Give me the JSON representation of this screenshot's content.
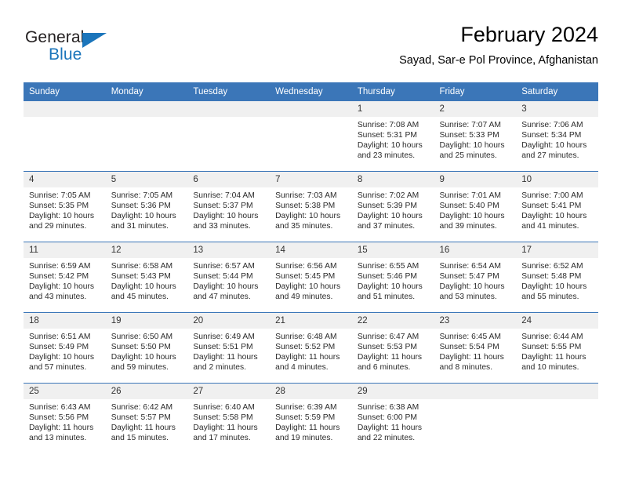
{
  "brand": {
    "name_part1": "General",
    "name_part2": "Blue"
  },
  "header": {
    "title": "February 2024",
    "subtitle": "Sayad, Sar-e Pol Province, Afghanistan"
  },
  "colors": {
    "header_blue": "#3b76b8",
    "brand_blue": "#1b75bb",
    "daynum_bg": "#f0f0f0"
  },
  "weekday_headers": [
    "Sunday",
    "Monday",
    "Tuesday",
    "Wednesday",
    "Thursday",
    "Friday",
    "Saturday"
  ],
  "weeks": [
    [
      {
        "day": "",
        "blank": true,
        "sunrise": "",
        "sunset": "",
        "daylight1": "",
        "daylight2": ""
      },
      {
        "day": "",
        "blank": true,
        "sunrise": "",
        "sunset": "",
        "daylight1": "",
        "daylight2": ""
      },
      {
        "day": "",
        "blank": true,
        "sunrise": "",
        "sunset": "",
        "daylight1": "",
        "daylight2": ""
      },
      {
        "day": "",
        "blank": true,
        "sunrise": "",
        "sunset": "",
        "daylight1": "",
        "daylight2": ""
      },
      {
        "day": "1",
        "sunrise": "Sunrise: 7:08 AM",
        "sunset": "Sunset: 5:31 PM",
        "daylight1": "Daylight: 10 hours",
        "daylight2": "and 23 minutes."
      },
      {
        "day": "2",
        "sunrise": "Sunrise: 7:07 AM",
        "sunset": "Sunset: 5:33 PM",
        "daylight1": "Daylight: 10 hours",
        "daylight2": "and 25 minutes."
      },
      {
        "day": "3",
        "sunrise": "Sunrise: 7:06 AM",
        "sunset": "Sunset: 5:34 PM",
        "daylight1": "Daylight: 10 hours",
        "daylight2": "and 27 minutes."
      }
    ],
    [
      {
        "day": "4",
        "sunrise": "Sunrise: 7:05 AM",
        "sunset": "Sunset: 5:35 PM",
        "daylight1": "Daylight: 10 hours",
        "daylight2": "and 29 minutes."
      },
      {
        "day": "5",
        "sunrise": "Sunrise: 7:05 AM",
        "sunset": "Sunset: 5:36 PM",
        "daylight1": "Daylight: 10 hours",
        "daylight2": "and 31 minutes."
      },
      {
        "day": "6",
        "sunrise": "Sunrise: 7:04 AM",
        "sunset": "Sunset: 5:37 PM",
        "daylight1": "Daylight: 10 hours",
        "daylight2": "and 33 minutes."
      },
      {
        "day": "7",
        "sunrise": "Sunrise: 7:03 AM",
        "sunset": "Sunset: 5:38 PM",
        "daylight1": "Daylight: 10 hours",
        "daylight2": "and 35 minutes."
      },
      {
        "day": "8",
        "sunrise": "Sunrise: 7:02 AM",
        "sunset": "Sunset: 5:39 PM",
        "daylight1": "Daylight: 10 hours",
        "daylight2": "and 37 minutes."
      },
      {
        "day": "9",
        "sunrise": "Sunrise: 7:01 AM",
        "sunset": "Sunset: 5:40 PM",
        "daylight1": "Daylight: 10 hours",
        "daylight2": "and 39 minutes."
      },
      {
        "day": "10",
        "sunrise": "Sunrise: 7:00 AM",
        "sunset": "Sunset: 5:41 PM",
        "daylight1": "Daylight: 10 hours",
        "daylight2": "and 41 minutes."
      }
    ],
    [
      {
        "day": "11",
        "sunrise": "Sunrise: 6:59 AM",
        "sunset": "Sunset: 5:42 PM",
        "daylight1": "Daylight: 10 hours",
        "daylight2": "and 43 minutes."
      },
      {
        "day": "12",
        "sunrise": "Sunrise: 6:58 AM",
        "sunset": "Sunset: 5:43 PM",
        "daylight1": "Daylight: 10 hours",
        "daylight2": "and 45 minutes."
      },
      {
        "day": "13",
        "sunrise": "Sunrise: 6:57 AM",
        "sunset": "Sunset: 5:44 PM",
        "daylight1": "Daylight: 10 hours",
        "daylight2": "and 47 minutes."
      },
      {
        "day": "14",
        "sunrise": "Sunrise: 6:56 AM",
        "sunset": "Sunset: 5:45 PM",
        "daylight1": "Daylight: 10 hours",
        "daylight2": "and 49 minutes."
      },
      {
        "day": "15",
        "sunrise": "Sunrise: 6:55 AM",
        "sunset": "Sunset: 5:46 PM",
        "daylight1": "Daylight: 10 hours",
        "daylight2": "and 51 minutes."
      },
      {
        "day": "16",
        "sunrise": "Sunrise: 6:54 AM",
        "sunset": "Sunset: 5:47 PM",
        "daylight1": "Daylight: 10 hours",
        "daylight2": "and 53 minutes."
      },
      {
        "day": "17",
        "sunrise": "Sunrise: 6:52 AM",
        "sunset": "Sunset: 5:48 PM",
        "daylight1": "Daylight: 10 hours",
        "daylight2": "and 55 minutes."
      }
    ],
    [
      {
        "day": "18",
        "sunrise": "Sunrise: 6:51 AM",
        "sunset": "Sunset: 5:49 PM",
        "daylight1": "Daylight: 10 hours",
        "daylight2": "and 57 minutes."
      },
      {
        "day": "19",
        "sunrise": "Sunrise: 6:50 AM",
        "sunset": "Sunset: 5:50 PM",
        "daylight1": "Daylight: 10 hours",
        "daylight2": "and 59 minutes."
      },
      {
        "day": "20",
        "sunrise": "Sunrise: 6:49 AM",
        "sunset": "Sunset: 5:51 PM",
        "daylight1": "Daylight: 11 hours",
        "daylight2": "and 2 minutes."
      },
      {
        "day": "21",
        "sunrise": "Sunrise: 6:48 AM",
        "sunset": "Sunset: 5:52 PM",
        "daylight1": "Daylight: 11 hours",
        "daylight2": "and 4 minutes."
      },
      {
        "day": "22",
        "sunrise": "Sunrise: 6:47 AM",
        "sunset": "Sunset: 5:53 PM",
        "daylight1": "Daylight: 11 hours",
        "daylight2": "and 6 minutes."
      },
      {
        "day": "23",
        "sunrise": "Sunrise: 6:45 AM",
        "sunset": "Sunset: 5:54 PM",
        "daylight1": "Daylight: 11 hours",
        "daylight2": "and 8 minutes."
      },
      {
        "day": "24",
        "sunrise": "Sunrise: 6:44 AM",
        "sunset": "Sunset: 5:55 PM",
        "daylight1": "Daylight: 11 hours",
        "daylight2": "and 10 minutes."
      }
    ],
    [
      {
        "day": "25",
        "sunrise": "Sunrise: 6:43 AM",
        "sunset": "Sunset: 5:56 PM",
        "daylight1": "Daylight: 11 hours",
        "daylight2": "and 13 minutes."
      },
      {
        "day": "26",
        "sunrise": "Sunrise: 6:42 AM",
        "sunset": "Sunset: 5:57 PM",
        "daylight1": "Daylight: 11 hours",
        "daylight2": "and 15 minutes."
      },
      {
        "day": "27",
        "sunrise": "Sunrise: 6:40 AM",
        "sunset": "Sunset: 5:58 PM",
        "daylight1": "Daylight: 11 hours",
        "daylight2": "and 17 minutes."
      },
      {
        "day": "28",
        "sunrise": "Sunrise: 6:39 AM",
        "sunset": "Sunset: 5:59 PM",
        "daylight1": "Daylight: 11 hours",
        "daylight2": "and 19 minutes."
      },
      {
        "day": "29",
        "sunrise": "Sunrise: 6:38 AM",
        "sunset": "Sunset: 6:00 PM",
        "daylight1": "Daylight: 11 hours",
        "daylight2": "and 22 minutes."
      },
      {
        "day": "",
        "blank": true,
        "sunrise": "",
        "sunset": "",
        "daylight1": "",
        "daylight2": ""
      },
      {
        "day": "",
        "blank": true,
        "sunrise": "",
        "sunset": "",
        "daylight1": "",
        "daylight2": ""
      }
    ]
  ]
}
